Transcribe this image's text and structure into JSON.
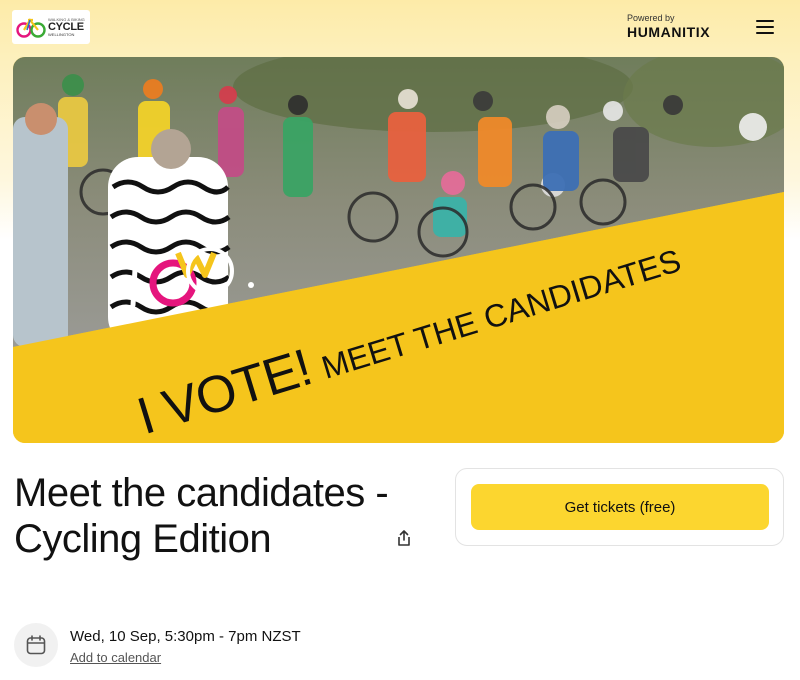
{
  "header": {
    "logo": {
      "small_text": "WALKING & BIKING",
      "main_text": "CYCLE",
      "sub_text": "WELLINGTON"
    },
    "powered_by_label": "Powered by",
    "powered_by_brand": "HUMANITIX",
    "menu_icon": "hamburger-menu-icon"
  },
  "banner": {
    "headline_big": "I VOTE!",
    "headline_small": "MEET THE CANDIDATES",
    "brand_color": "#f5c51c",
    "accent_colors": [
      "#e5157d",
      "#f5c51c",
      "#ffffff"
    ]
  },
  "event": {
    "title": "Meet the candidates - Cycling Edition",
    "share_icon": "share-icon",
    "date_text": "Wed, 10 Sep, 5:30pm - 7pm NZST",
    "add_calendar_label": "Add to calendar",
    "calendar_icon": "calendar-icon"
  },
  "tickets": {
    "button_label": "Get tickets (free)",
    "button_color": "#fcd62f"
  }
}
